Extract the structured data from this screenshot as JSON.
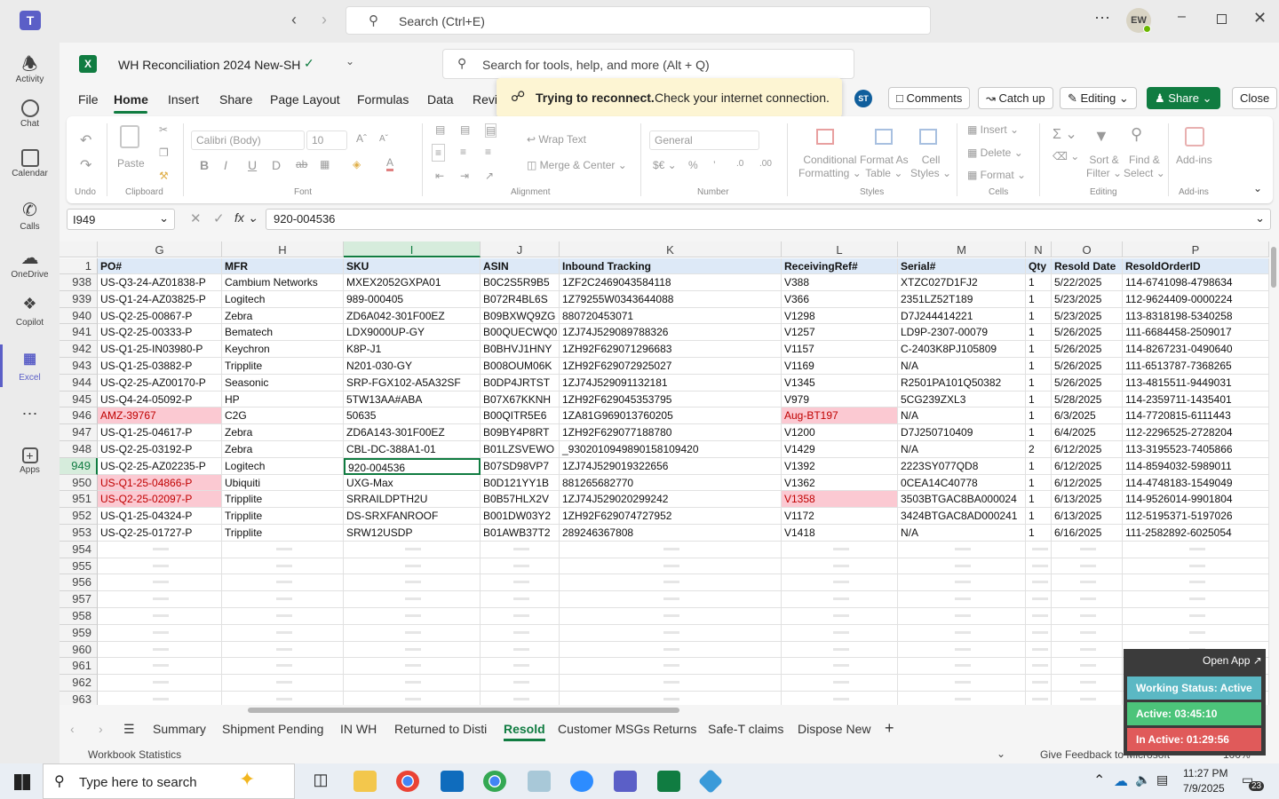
{
  "teams": {
    "search_placeholder": "Search (Ctrl+E)",
    "avatar_initials": "EW"
  },
  "rail": [
    {
      "label": "Activity"
    },
    {
      "label": "Chat"
    },
    {
      "label": "Calendar"
    },
    {
      "label": "Calls"
    },
    {
      "label": "OneDrive"
    },
    {
      "label": "Copilot"
    },
    {
      "label": "Excel"
    },
    {
      "label": "Apps"
    }
  ],
  "workbook": {
    "title": "WH Reconciliation 2024 New-SH",
    "tools_search": "Search for tools, help, and more (Alt + Q)"
  },
  "menu": [
    "File",
    "Home",
    "Insert",
    "Share",
    "Page Layout",
    "Formulas",
    "Data",
    "Revi"
  ],
  "toast": {
    "bold": "Trying to reconnect.",
    "text": "Check your internet connection."
  },
  "actions": {
    "user": "ST",
    "comments": "Comments",
    "catchup": "Catch up",
    "editing": "Editing",
    "share": "Share",
    "close": "Close"
  },
  "ribbon": {
    "undo": "Undo",
    "clipboard": "Clipboard",
    "paste": "Paste",
    "font_name": "Calibri (Body)",
    "font_size": "10",
    "font": "Font",
    "wrap": "Wrap Text",
    "merge": "Merge & Center",
    "alignment": "Alignment",
    "numfmt": "General",
    "number": "Number",
    "cond1": "Conditional",
    "cond2": "Formatting",
    "fmt1": "Format As",
    "fmt2": "Table",
    "cs1": "Cell",
    "cs2": "Styles",
    "styles": "Styles",
    "insert": "Insert",
    "delete": "Delete",
    "format": "Format",
    "cells": "Cells",
    "sort1": "Sort &",
    "sort2": "Filter",
    "find1": "Find &",
    "find2": "Select",
    "editing": "Editing",
    "addins": "Add-ins"
  },
  "formula": {
    "namebox": "I949",
    "value": "920-004536"
  },
  "columns": [
    "G",
    "H",
    "I",
    "J",
    "K",
    "L",
    "M",
    "N",
    "O",
    "P"
  ],
  "header_row": {
    "num": "1",
    "cells": [
      "PO#",
      "MFR",
      "SKU",
      "ASIN",
      "Inbound Tracking",
      "ReceivingRef#",
      "Serial#",
      "Qty",
      "Resold Date",
      "ResoldOrderID"
    ]
  },
  "rows": [
    {
      "num": "938",
      "cells": [
        "US-Q3-24-AZ01838-P",
        "Cambium Networks",
        "MXEX2052GXPA01",
        "B0C2S5R9B5",
        "1ZF2C2469043584118",
        "V388",
        "XTZC027D1FJ2",
        "1",
        "5/22/2025",
        "114-6741098-4798634"
      ]
    },
    {
      "num": "939",
      "cells": [
        "US-Q1-24-AZ03825-P",
        "Logitech",
        "989-000405",
        "B072R4BL6S",
        "1Z79255W0343644088",
        "V366",
        "2351LZ52T189",
        "1",
        "5/23/2025",
        "112-9624409-0000224"
      ]
    },
    {
      "num": "940",
      "cells": [
        "US-Q2-25-00867-P",
        "Zebra",
        "ZD6A042-301F00EZ",
        "B09BXWQ9ZG",
        "880720453071",
        "V1298",
        "D7J244414221",
        "1",
        "5/23/2025",
        "113-8318198-5340258"
      ]
    },
    {
      "num": "941",
      "cells": [
        "US-Q2-25-00333-P",
        "Bematech",
        "LDX9000UP-GY",
        "B00QUECWQ0",
        "1ZJ74J529089788326",
        "V1257",
        "LD9P-2307-00079",
        "1",
        "5/26/2025",
        "111-6684458-2509017"
      ]
    },
    {
      "num": "942",
      "cells": [
        "US-Q1-25-IN03980-P",
        "Keychron",
        "K8P-J1",
        "B0BHVJ1HNY",
        "1ZH92F629071296683",
        "V1157",
        "C-2403K8PJ105809",
        "1",
        "5/26/2025",
        "114-8267231-0490640"
      ]
    },
    {
      "num": "943",
      "cells": [
        "US-Q1-25-03882-P",
        "Tripplite",
        "N201-030-GY",
        "B008OUM06K",
        "1ZH92F629072925027",
        "V1169",
        "N/A",
        "1",
        "5/26/2025",
        "111-6513787-7368265"
      ]
    },
    {
      "num": "944",
      "cells": [
        "US-Q2-25-AZ00170-P",
        "Seasonic",
        "SRP-FGX102-A5A32SF",
        "B0DP4JRTST",
        "1ZJ74J529091132181",
        "V1345",
        "R2501PA101Q50382",
        "1",
        "5/26/2025",
        "113-4815511-9449031"
      ]
    },
    {
      "num": "945",
      "cells": [
        "US-Q4-24-05092-P",
        "HP",
        "5TW13AA#ABA",
        "B07X67KKNH",
        "1ZH92F629045353795",
        "V979",
        "5CG239ZXL3",
        "1",
        "5/28/2025",
        "114-2359711-1435401"
      ]
    },
    {
      "num": "946",
      "cells": [
        "AMZ-39767",
        "C2G",
        "50635",
        "B00QITR5E6",
        "1ZA81G969013760205",
        "Aug-BT197",
        "N/A",
        "1",
        "6/3/2025",
        "114-7720815-6111443"
      ]
    },
    {
      "num": "947",
      "cells": [
        "US-Q1-25-04617-P",
        "Zebra",
        "ZD6A143-301F00EZ",
        "B09BY4P8RT",
        "1ZH92F629077188780",
        "V1200",
        "D7J250710409",
        "1",
        "6/4/2025",
        "112-2296525-2728204"
      ]
    },
    {
      "num": "948",
      "cells": [
        "US-Q2-25-03192-P",
        "Zebra",
        "CBL-DC-388A1-01",
        "B01LZSVEWO",
        "_9302010949890158109420",
        "V1429",
        "N/A",
        "2",
        "6/12/2025",
        "113-3195523-7405866"
      ]
    },
    {
      "num": "949",
      "cells": [
        "US-Q2-25-AZ02235-P",
        "Logitech",
        "920-004536",
        "B07SD98VP7",
        "1ZJ74J529019322656",
        "V1392",
        "2223SY077QD8",
        "1",
        "6/12/2025",
        "114-8594032-5989011"
      ]
    },
    {
      "num": "950",
      "cells": [
        "US-Q1-25-04866-P",
        "Ubiquiti",
        "UXG-Max",
        "B0D121YY1B",
        "881265682770",
        "V1362",
        "0CEA14C40778",
        "1",
        "6/12/2025",
        "114-4748183-1549049"
      ]
    },
    {
      "num": "951",
      "cells": [
        "US-Q2-25-02097-P",
        "Tripplite",
        "SRRAILDPTH2U",
        "B0B57HLX2V",
        "1ZJ74J529020299242",
        "V1358",
        "3503BTGAC8BA000024",
        "1",
        "6/13/2025",
        "114-9526014-9901804"
      ]
    },
    {
      "num": "952",
      "cells": [
        "US-Q1-25-04324-P",
        "Tripplite",
        "DS-SRXFANROOF",
        "B001DW03Y2",
        "1ZH92F629074727952",
        "V1172",
        "3424BTGAC8AD000241",
        "1",
        "6/13/2025",
        "112-5195371-5197026"
      ]
    },
    {
      "num": "953",
      "cells": [
        "US-Q2-25-01727-P",
        "Tripplite",
        "SRW12USDP",
        "B01AWB37T2",
        "289246367808",
        "V1418",
        "N/A",
        "1",
        "6/16/2025",
        "111-2582892-6025054"
      ]
    }
  ],
  "empty_rows": [
    "954",
    "955",
    "956",
    "957",
    "958",
    "959",
    "960",
    "961",
    "962",
    "963"
  ],
  "highlight": {
    "pink": "#fbc9d2",
    "red_text": "#c00000",
    "green": "#107c41",
    "selected": "949"
  },
  "sheets": [
    "Summary",
    "Shipment Pending",
    "IN WH",
    "Returned to Disti",
    "Resold",
    "Customer MSGs Returns",
    "Safe-T claims",
    "Dispose New"
  ],
  "active_sheet": "Resold",
  "status": {
    "left": "Workbook Statistics",
    "feedback": "Give Feedback to Microsoft",
    "zoom": "100%"
  },
  "widget": {
    "open": "Open App",
    "working": "Working Status: Active",
    "active": "Active: 03:45:10",
    "inactive": "In Active: 01:29:56"
  },
  "taskbar": {
    "search": "Type here to search",
    "time": "11:27 PM",
    "date": "7/9/2025",
    "notif": "23"
  }
}
